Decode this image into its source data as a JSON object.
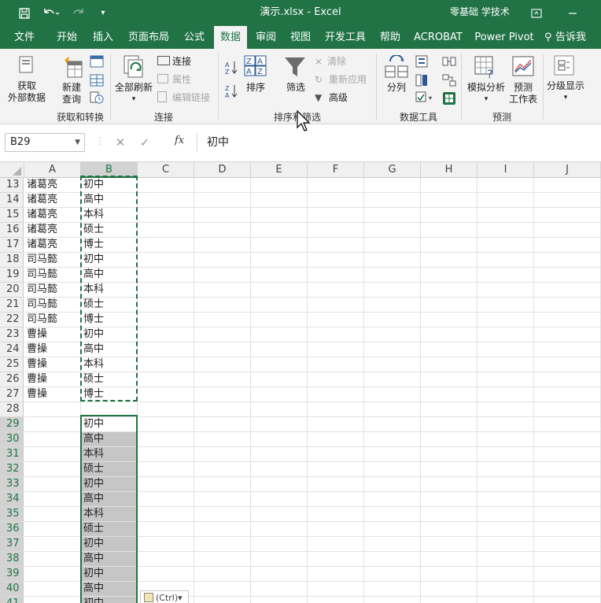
{
  "titlebar": {
    "title": "演示.xlsx  -  Excel",
    "user": "零基础 学技术",
    "customize": "▾"
  },
  "tabs": [
    {
      "label": "文件",
      "active": false
    },
    {
      "label": "开始",
      "active": false
    },
    {
      "label": "插入",
      "active": false
    },
    {
      "label": "页面布局",
      "active": false
    },
    {
      "label": "公式",
      "active": false
    },
    {
      "label": "数据",
      "active": true
    },
    {
      "label": "审阅",
      "active": false
    },
    {
      "label": "视图",
      "active": false
    },
    {
      "label": "开发工具",
      "active": false
    },
    {
      "label": "帮助",
      "active": false
    },
    {
      "label": "ACROBAT",
      "active": false
    },
    {
      "label": "Power Pivot",
      "active": false
    }
  ],
  "tell_me": "告诉我",
  "ribbon": {
    "get_external_line1": "获取",
    "get_external_line2": "外部数据",
    "new_query_line1": "新建",
    "new_query_line2": "查询",
    "group_get_transform": "获取和转换",
    "refresh_all": "全部刷新",
    "connections": "连接",
    "properties": "属性",
    "edit_links": "编辑链接",
    "group_connections": "连接",
    "sort": "排序",
    "filter": "筛选",
    "clear": "清除",
    "reapply": "重新应用",
    "advanced": "高级",
    "group_sort_filter": "排序和筛选",
    "text_to_columns": "分列",
    "group_data_tools": "数据工具",
    "what_if": "模拟分析",
    "forecast_line1": "预测",
    "forecast_line2": "工作表",
    "group_forecast": "预测",
    "outline": "分级显示"
  },
  "formula_bar": {
    "name_box": "B29",
    "fx": "fx",
    "content": "初中"
  },
  "columns": [
    "A",
    "B",
    "C",
    "D",
    "E",
    "F",
    "G",
    "H",
    "I",
    "J"
  ],
  "selected_column": "B",
  "rows": [
    {
      "num": "13",
      "a": "诸葛亮",
      "b": "初中"
    },
    {
      "num": "14",
      "a": "诸葛亮",
      "b": "高中"
    },
    {
      "num": "15",
      "a": "诸葛亮",
      "b": "本科"
    },
    {
      "num": "16",
      "a": "诸葛亮",
      "b": "硕士"
    },
    {
      "num": "17",
      "a": "诸葛亮",
      "b": "博士"
    },
    {
      "num": "18",
      "a": "司马懿",
      "b": "初中"
    },
    {
      "num": "19",
      "a": "司马懿",
      "b": "高中"
    },
    {
      "num": "20",
      "a": "司马懿",
      "b": "本科"
    },
    {
      "num": "21",
      "a": "司马懿",
      "b": "硕士"
    },
    {
      "num": "22",
      "a": "司马懿",
      "b": "博士"
    },
    {
      "num": "23",
      "a": "曹操",
      "b": "初中"
    },
    {
      "num": "24",
      "a": "曹操",
      "b": "高中"
    },
    {
      "num": "25",
      "a": "曹操",
      "b": "本科"
    },
    {
      "num": "26",
      "a": "曹操",
      "b": "硕士"
    },
    {
      "num": "27",
      "a": "曹操",
      "b": "博士"
    },
    {
      "num": "28",
      "a": "",
      "b": ""
    },
    {
      "num": "29",
      "a": "",
      "b": "初中"
    },
    {
      "num": "30",
      "a": "",
      "b": "高中"
    },
    {
      "num": "31",
      "a": "",
      "b": "本科"
    },
    {
      "num": "32",
      "a": "",
      "b": "硕士"
    },
    {
      "num": "33",
      "a": "",
      "b": "初中"
    },
    {
      "num": "34",
      "a": "",
      "b": "高中"
    },
    {
      "num": "35",
      "a": "",
      "b": "本科"
    },
    {
      "num": "36",
      "a": "",
      "b": "硕士"
    },
    {
      "num": "37",
      "a": "",
      "b": "初中"
    },
    {
      "num": "38",
      "a": "",
      "b": "高中"
    },
    {
      "num": "39",
      "a": "",
      "b": "初中"
    },
    {
      "num": "40",
      "a": "",
      "b": "高中"
    },
    {
      "num": "41",
      "a": "",
      "b": "初中"
    }
  ],
  "paste_options": "(Ctrl)",
  "colors": {
    "accent": "#217346",
    "selection_fill": "#c6c6c6"
  }
}
